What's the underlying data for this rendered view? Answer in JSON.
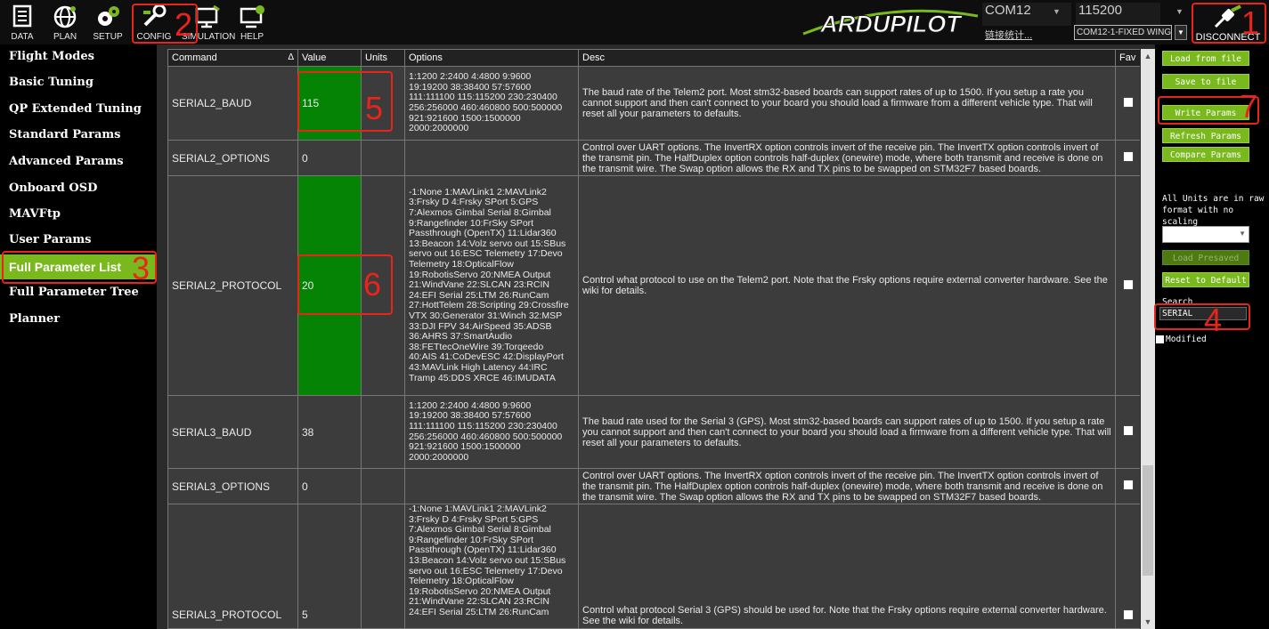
{
  "toolbar": {
    "items": [
      {
        "label": "DATA",
        "icon": "data-icon"
      },
      {
        "label": "PLAN",
        "icon": "globe-icon"
      },
      {
        "label": "SETUP",
        "icon": "setup-icon"
      },
      {
        "label": "CONFIG",
        "icon": "config-icon"
      },
      {
        "label": "SIMULATION",
        "icon": "simulation-icon"
      },
      {
        "label": "HELP",
        "icon": "help-icon"
      }
    ],
    "logo_text": "ARDUPILOT",
    "com_port": "COM12",
    "com_link": "链接统计...",
    "baud_rate": "115200",
    "vehicle": "COM12-1-FIXED WING",
    "disconnect_label": "DISCONNECT"
  },
  "nav": {
    "items": [
      {
        "label": "Flight Modes"
      },
      {
        "label": "Basic Tuning"
      },
      {
        "label": "QP Extended Tuning"
      },
      {
        "label": "Standard Params"
      },
      {
        "label": "Advanced Params"
      },
      {
        "label": "Onboard OSD"
      },
      {
        "label": "MAVFtp"
      },
      {
        "label": "User Params"
      },
      {
        "label": "Full Parameter List"
      },
      {
        "label": "Full Parameter Tree"
      },
      {
        "label": "Planner"
      }
    ],
    "active_index": 8
  },
  "table": {
    "headers": {
      "command": "Command",
      "sort_glyph": "Δ",
      "value": "Value",
      "units": "Units",
      "options": "Options",
      "desc": "Desc",
      "fav": "Fav"
    },
    "rows": [
      {
        "command": "SERIAL2_BAUD",
        "value": "115",
        "units": "",
        "options": "1:1200 2:2400 4:4800 9:9600\n19:19200 38:38400 57:57600\n111:111100 115:115200 230:230400\n256:256000 460:460800 500:500000\n921:921600 1500:1500000\n2000:2000000",
        "desc": "The baud rate of the Telem2 port. Most stm32-based boards can support rates of up to 1500. If you setup a rate you cannot support and then can't connect to your board you should load a firmware from a different vehicle type. That will reset all your parameters to defaults.",
        "highlight": true
      },
      {
        "command": "SERIAL2_OPTIONS",
        "value": "0",
        "units": "",
        "options": "",
        "desc": "Control over UART options. The InvertRX option controls invert of the receive pin. The InvertTX option controls invert of the transmit pin. The HalfDuplex option controls half-duplex (onewire) mode, where both transmit and receive is done on the transmit wire. The Swap option allows the RX and TX pins to be swapped on STM32F7 based boards.",
        "highlight": false
      },
      {
        "command": "SERIAL2_PROTOCOL",
        "value": "20",
        "units": "",
        "options": "-1:None 1:MAVLink1 2:MAVLink2\n3:Frsky D 4:Frsky SPort 5:GPS\n7:Alexmos Gimbal Serial 8:Gimbal\n9:Rangefinder 10:FrSky SPort\nPassthrough (OpenTX) 11:Lidar360\n13:Beacon 14:Volz servo out 15:SBus\nservo out 16:ESC Telemetry 17:Devo\nTelemetry 18:OpticalFlow\n19:RobotisServo 20:NMEA Output\n21:WindVane 22:SLCAN 23:RCIN\n24:EFI Serial 25:LTM 26:RunCam\n27:HottTelem 28:Scripting 29:Crossfire\nVTX 30:Generator 31:Winch 32:MSP\n33:DJI FPV 34:AirSpeed 35:ADSB\n36:AHRS 37:SmartAudio\n38:FETtecOneWire 39:Torqeedo\n40:AIS 41:CoDevESC 42:DisplayPort\n43:MAVLink High Latency 44:IRC\nTramp 45:DDS XRCE 46:IMUDATA",
        "desc": "Control what protocol to use on the Telem2 port. Note that the Frsky options require external converter hardware. See the wiki for details.",
        "highlight": true
      },
      {
        "command": "SERIAL3_BAUD",
        "value": "38",
        "units": "",
        "options": "1:1200 2:2400 4:4800 9:9600\n19:19200 38:38400 57:57600\n111:111100 115:115200 230:230400\n256:256000 460:460800 500:500000\n921:921600 1500:1500000\n2000:2000000",
        "desc": "The baud rate used for the Serial 3 (GPS). Most stm32-based boards can support rates of up to 1500. If you setup a rate you cannot support and then can't connect to your board you should load a firmware from a different vehicle type. That will reset all your parameters to defaults.",
        "highlight": false
      },
      {
        "command": "SERIAL3_OPTIONS",
        "value": "0",
        "units": "",
        "options": "",
        "desc": "Control over UART options. The InvertRX option controls invert of the receive pin. The InvertTX option controls invert of the transmit pin. The HalfDuplex option controls half-duplex (onewire) mode, where both transmit and receive is done on the transmit wire. The Swap option allows the RX and TX pins to be swapped on STM32F7 based boards.",
        "highlight": false
      },
      {
        "command": "SERIAL3_PROTOCOL",
        "value": "5",
        "units": "",
        "options": "-1:None 1:MAVLink1 2:MAVLink2\n3:Frsky D 4:Frsky SPort 5:GPS\n7:Alexmos Gimbal Serial 8:Gimbal\n9:Rangefinder 10:FrSky SPort\nPassthrough (OpenTX) 11:Lidar360\n13:Beacon 14:Volz servo out 15:SBus\nservo out 16:ESC Telemetry 17:Devo\nTelemetry 18:OpticalFlow\n19:RobotisServo 20:NMEA Output\n21:WindVane 22:SLCAN 23:RCIN\n24:EFI Serial 25:LTM 26:RunCam",
        "desc": "Control what protocol Serial 3 (GPS) should be used for. Note that the Frsky options require external converter hardware. See the wiki for details.",
        "highlight": false
      }
    ]
  },
  "right_panel": {
    "buttons": [
      {
        "label": "Load from file",
        "enabled": true
      },
      {
        "label": "Save to file",
        "enabled": true
      },
      {
        "label": "Write Params",
        "enabled": true
      },
      {
        "label": "Refresh Params",
        "enabled": true
      },
      {
        "label": "Compare Params",
        "enabled": true
      }
    ],
    "units_note": "All Units are in raw format with no scaling",
    "load_presaved": "Load Presaved",
    "reset_default": "Reset to Default",
    "search_label": "Search",
    "search_value": "SERIAL",
    "modified_label": "Modified"
  },
  "annotations": [
    "1",
    "2",
    "3",
    "4",
    "5",
    "6",
    "7"
  ],
  "colors": {
    "accent_green": "#7ab91d",
    "value_green": "#058305",
    "annotation_red": "#e8241b"
  }
}
